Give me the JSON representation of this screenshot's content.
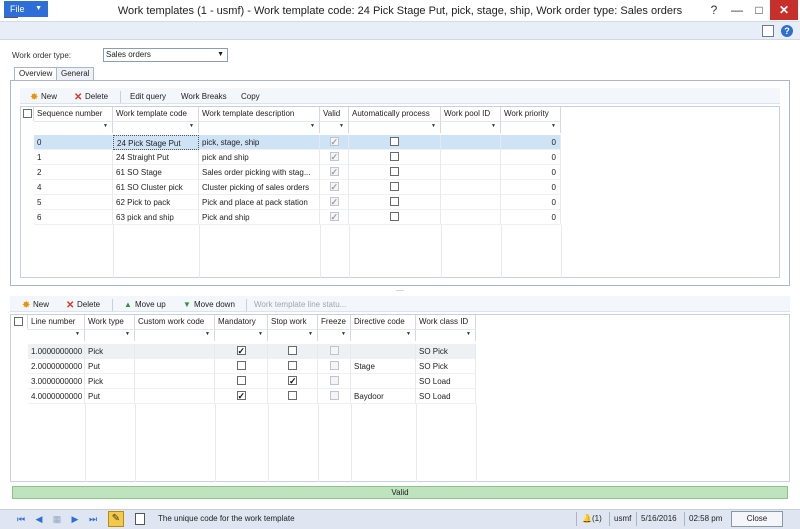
{
  "window": {
    "title": "Work templates (1 - usmf) - Work template code: 24 Pick Stage Put, pick, stage, ship, Work order type: Sales orders",
    "help_glyph": "?",
    "min_glyph": "—",
    "max_glyph": "□",
    "close_glyph": "✕"
  },
  "menu": {
    "file_label": "File",
    "help_glyph": "?"
  },
  "work_order_type": {
    "label": "Work order type:",
    "value": "Sales orders"
  },
  "tabs": [
    {
      "label": "Overview",
      "active": true
    },
    {
      "label": "General",
      "active": false
    }
  ],
  "templates_toolbar": {
    "new_label": "New",
    "delete_label": "Delete",
    "edit_query_label": "Edit query",
    "work_breaks_label": "Work Breaks",
    "copy_label": "Copy"
  },
  "templates_grid": {
    "columns": [
      "Sequence number",
      "Work template code",
      "Work template description",
      "Valid",
      "Automatically process",
      "Work pool ID",
      "Work priority"
    ],
    "rows": [
      {
        "seq": "0",
        "code": "24 Pick Stage Put",
        "desc": "pick, stage, ship",
        "valid": true,
        "auto": false,
        "pool": "",
        "priority": "0"
      },
      {
        "seq": "1",
        "code": "24 Straight Put",
        "desc": "pick and ship",
        "valid": true,
        "auto": false,
        "pool": "",
        "priority": "0"
      },
      {
        "seq": "2",
        "code": "61 SO Stage",
        "desc": "Sales order picking with stag...",
        "valid": true,
        "auto": false,
        "pool": "",
        "priority": "0"
      },
      {
        "seq": "4",
        "code": "61 SO Cluster pick",
        "desc": "Cluster picking of sales orders",
        "valid": true,
        "auto": false,
        "pool": "",
        "priority": "0"
      },
      {
        "seq": "5",
        "code": "62 Pick to pack",
        "desc": "Pick and place at pack station",
        "valid": true,
        "auto": false,
        "pool": "",
        "priority": "0"
      },
      {
        "seq": "6",
        "code": "63 pick and ship",
        "desc": "Pick and ship",
        "valid": true,
        "auto": false,
        "pool": "",
        "priority": "0"
      }
    ]
  },
  "splitter_glyph": "....",
  "lines_toolbar": {
    "new_label": "New",
    "delete_label": "Delete",
    "move_up_label": "Move up",
    "move_down_label": "Move down",
    "status_label": "Work template line statu..."
  },
  "lines_grid": {
    "columns": [
      "Line number",
      "Work type",
      "Custom work code",
      "Mandatory",
      "Stop work",
      "Freeze",
      "Directive code",
      "Work class ID"
    ],
    "rows": [
      {
        "line": "1.0000000000",
        "type": "Pick",
        "custom": "",
        "mandatory": true,
        "stop": false,
        "freeze": false,
        "directive": "",
        "work_class": "SO Pick"
      },
      {
        "line": "2.0000000000",
        "type": "Put",
        "custom": "",
        "mandatory": false,
        "stop": false,
        "freeze": false,
        "directive": "Stage",
        "work_class": "SO Pick"
      },
      {
        "line": "3.0000000000",
        "type": "Pick",
        "custom": "",
        "mandatory": false,
        "stop": true,
        "freeze": false,
        "directive": "",
        "work_class": "SO Load"
      },
      {
        "line": "4.0000000000",
        "type": "Put",
        "custom": "",
        "mandatory": true,
        "stop": false,
        "freeze": false,
        "directive": "Baydoor",
        "work_class": "SO Load"
      }
    ]
  },
  "validation_status": "Valid",
  "status_bar": {
    "help_text": "The unique code for the work template",
    "notifications": "(1)",
    "company": "usmf",
    "date": "5/16/2016",
    "time": "02:58 pm",
    "close_label": "Close"
  }
}
